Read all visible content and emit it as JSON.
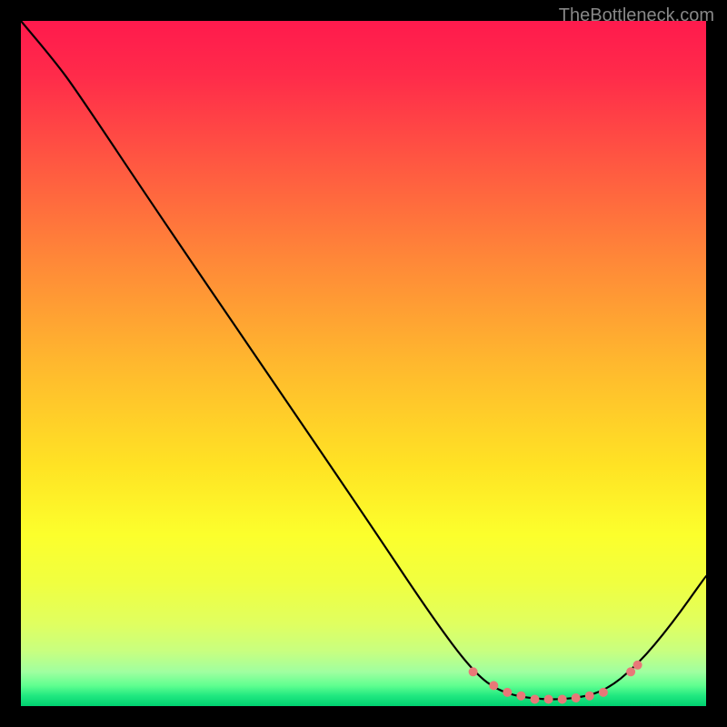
{
  "watermark": "TheBottleneck.com",
  "chart_data": {
    "type": "line",
    "title": "",
    "xlabel": "",
    "ylabel": "",
    "xlim": [
      0,
      100
    ],
    "ylim": [
      0,
      100
    ],
    "curve_points": [
      {
        "x": 0,
        "y": 100
      },
      {
        "x": 5,
        "y": 94
      },
      {
        "x": 8,
        "y": 90
      },
      {
        "x": 20,
        "y": 72
      },
      {
        "x": 35,
        "y": 50
      },
      {
        "x": 50,
        "y": 28
      },
      {
        "x": 60,
        "y": 13
      },
      {
        "x": 66,
        "y": 5
      },
      {
        "x": 70,
        "y": 2
      },
      {
        "x": 75,
        "y": 1
      },
      {
        "x": 80,
        "y": 1
      },
      {
        "x": 85,
        "y": 2
      },
      {
        "x": 90,
        "y": 6
      },
      {
        "x": 95,
        "y": 12
      },
      {
        "x": 100,
        "y": 19
      }
    ],
    "markers": [
      {
        "x": 66,
        "y": 5
      },
      {
        "x": 69,
        "y": 3
      },
      {
        "x": 71,
        "y": 2
      },
      {
        "x": 73,
        "y": 1.5
      },
      {
        "x": 75,
        "y": 1
      },
      {
        "x": 77,
        "y": 1
      },
      {
        "x": 79,
        "y": 1
      },
      {
        "x": 81,
        "y": 1.2
      },
      {
        "x": 83,
        "y": 1.5
      },
      {
        "x": 85,
        "y": 2
      },
      {
        "x": 89,
        "y": 5
      },
      {
        "x": 90,
        "y": 6
      }
    ],
    "marker_color": "#e87878",
    "curve_color": "#000000"
  }
}
